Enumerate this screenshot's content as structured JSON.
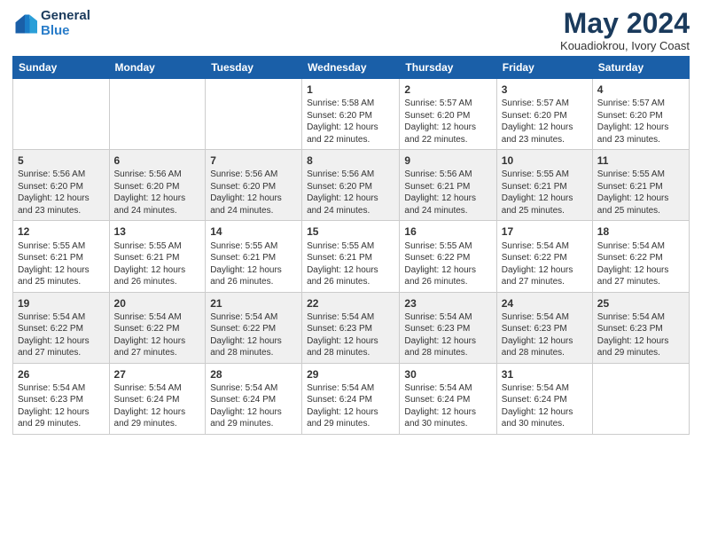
{
  "header": {
    "logo_line1": "General",
    "logo_line2": "Blue",
    "month_year": "May 2024",
    "location": "Kouadiokrou, Ivory Coast"
  },
  "weekdays": [
    "Sunday",
    "Monday",
    "Tuesday",
    "Wednesday",
    "Thursday",
    "Friday",
    "Saturday"
  ],
  "weeks": [
    [
      {
        "day": "",
        "info": ""
      },
      {
        "day": "",
        "info": ""
      },
      {
        "day": "",
        "info": ""
      },
      {
        "day": "1",
        "info": "Sunrise: 5:58 AM\nSunset: 6:20 PM\nDaylight: 12 hours\nand 22 minutes."
      },
      {
        "day": "2",
        "info": "Sunrise: 5:57 AM\nSunset: 6:20 PM\nDaylight: 12 hours\nand 22 minutes."
      },
      {
        "day": "3",
        "info": "Sunrise: 5:57 AM\nSunset: 6:20 PM\nDaylight: 12 hours\nand 23 minutes."
      },
      {
        "day": "4",
        "info": "Sunrise: 5:57 AM\nSunset: 6:20 PM\nDaylight: 12 hours\nand 23 minutes."
      }
    ],
    [
      {
        "day": "5",
        "info": "Sunrise: 5:56 AM\nSunset: 6:20 PM\nDaylight: 12 hours\nand 23 minutes."
      },
      {
        "day": "6",
        "info": "Sunrise: 5:56 AM\nSunset: 6:20 PM\nDaylight: 12 hours\nand 24 minutes."
      },
      {
        "day": "7",
        "info": "Sunrise: 5:56 AM\nSunset: 6:20 PM\nDaylight: 12 hours\nand 24 minutes."
      },
      {
        "day": "8",
        "info": "Sunrise: 5:56 AM\nSunset: 6:20 PM\nDaylight: 12 hours\nand 24 minutes."
      },
      {
        "day": "9",
        "info": "Sunrise: 5:56 AM\nSunset: 6:21 PM\nDaylight: 12 hours\nand 24 minutes."
      },
      {
        "day": "10",
        "info": "Sunrise: 5:55 AM\nSunset: 6:21 PM\nDaylight: 12 hours\nand 25 minutes."
      },
      {
        "day": "11",
        "info": "Sunrise: 5:55 AM\nSunset: 6:21 PM\nDaylight: 12 hours\nand 25 minutes."
      }
    ],
    [
      {
        "day": "12",
        "info": "Sunrise: 5:55 AM\nSunset: 6:21 PM\nDaylight: 12 hours\nand 25 minutes."
      },
      {
        "day": "13",
        "info": "Sunrise: 5:55 AM\nSunset: 6:21 PM\nDaylight: 12 hours\nand 26 minutes."
      },
      {
        "day": "14",
        "info": "Sunrise: 5:55 AM\nSunset: 6:21 PM\nDaylight: 12 hours\nand 26 minutes."
      },
      {
        "day": "15",
        "info": "Sunrise: 5:55 AM\nSunset: 6:21 PM\nDaylight: 12 hours\nand 26 minutes."
      },
      {
        "day": "16",
        "info": "Sunrise: 5:55 AM\nSunset: 6:22 PM\nDaylight: 12 hours\nand 26 minutes."
      },
      {
        "day": "17",
        "info": "Sunrise: 5:54 AM\nSunset: 6:22 PM\nDaylight: 12 hours\nand 27 minutes."
      },
      {
        "day": "18",
        "info": "Sunrise: 5:54 AM\nSunset: 6:22 PM\nDaylight: 12 hours\nand 27 minutes."
      }
    ],
    [
      {
        "day": "19",
        "info": "Sunrise: 5:54 AM\nSunset: 6:22 PM\nDaylight: 12 hours\nand 27 minutes."
      },
      {
        "day": "20",
        "info": "Sunrise: 5:54 AM\nSunset: 6:22 PM\nDaylight: 12 hours\nand 27 minutes."
      },
      {
        "day": "21",
        "info": "Sunrise: 5:54 AM\nSunset: 6:22 PM\nDaylight: 12 hours\nand 28 minutes."
      },
      {
        "day": "22",
        "info": "Sunrise: 5:54 AM\nSunset: 6:23 PM\nDaylight: 12 hours\nand 28 minutes."
      },
      {
        "day": "23",
        "info": "Sunrise: 5:54 AM\nSunset: 6:23 PM\nDaylight: 12 hours\nand 28 minutes."
      },
      {
        "day": "24",
        "info": "Sunrise: 5:54 AM\nSunset: 6:23 PM\nDaylight: 12 hours\nand 28 minutes."
      },
      {
        "day": "25",
        "info": "Sunrise: 5:54 AM\nSunset: 6:23 PM\nDaylight: 12 hours\nand 29 minutes."
      }
    ],
    [
      {
        "day": "26",
        "info": "Sunrise: 5:54 AM\nSunset: 6:23 PM\nDaylight: 12 hours\nand 29 minutes."
      },
      {
        "day": "27",
        "info": "Sunrise: 5:54 AM\nSunset: 6:24 PM\nDaylight: 12 hours\nand 29 minutes."
      },
      {
        "day": "28",
        "info": "Sunrise: 5:54 AM\nSunset: 6:24 PM\nDaylight: 12 hours\nand 29 minutes."
      },
      {
        "day": "29",
        "info": "Sunrise: 5:54 AM\nSunset: 6:24 PM\nDaylight: 12 hours\nand 29 minutes."
      },
      {
        "day": "30",
        "info": "Sunrise: 5:54 AM\nSunset: 6:24 PM\nDaylight: 12 hours\nand 30 minutes."
      },
      {
        "day": "31",
        "info": "Sunrise: 5:54 AM\nSunset: 6:24 PM\nDaylight: 12 hours\nand 30 minutes."
      },
      {
        "day": "",
        "info": ""
      }
    ]
  ]
}
